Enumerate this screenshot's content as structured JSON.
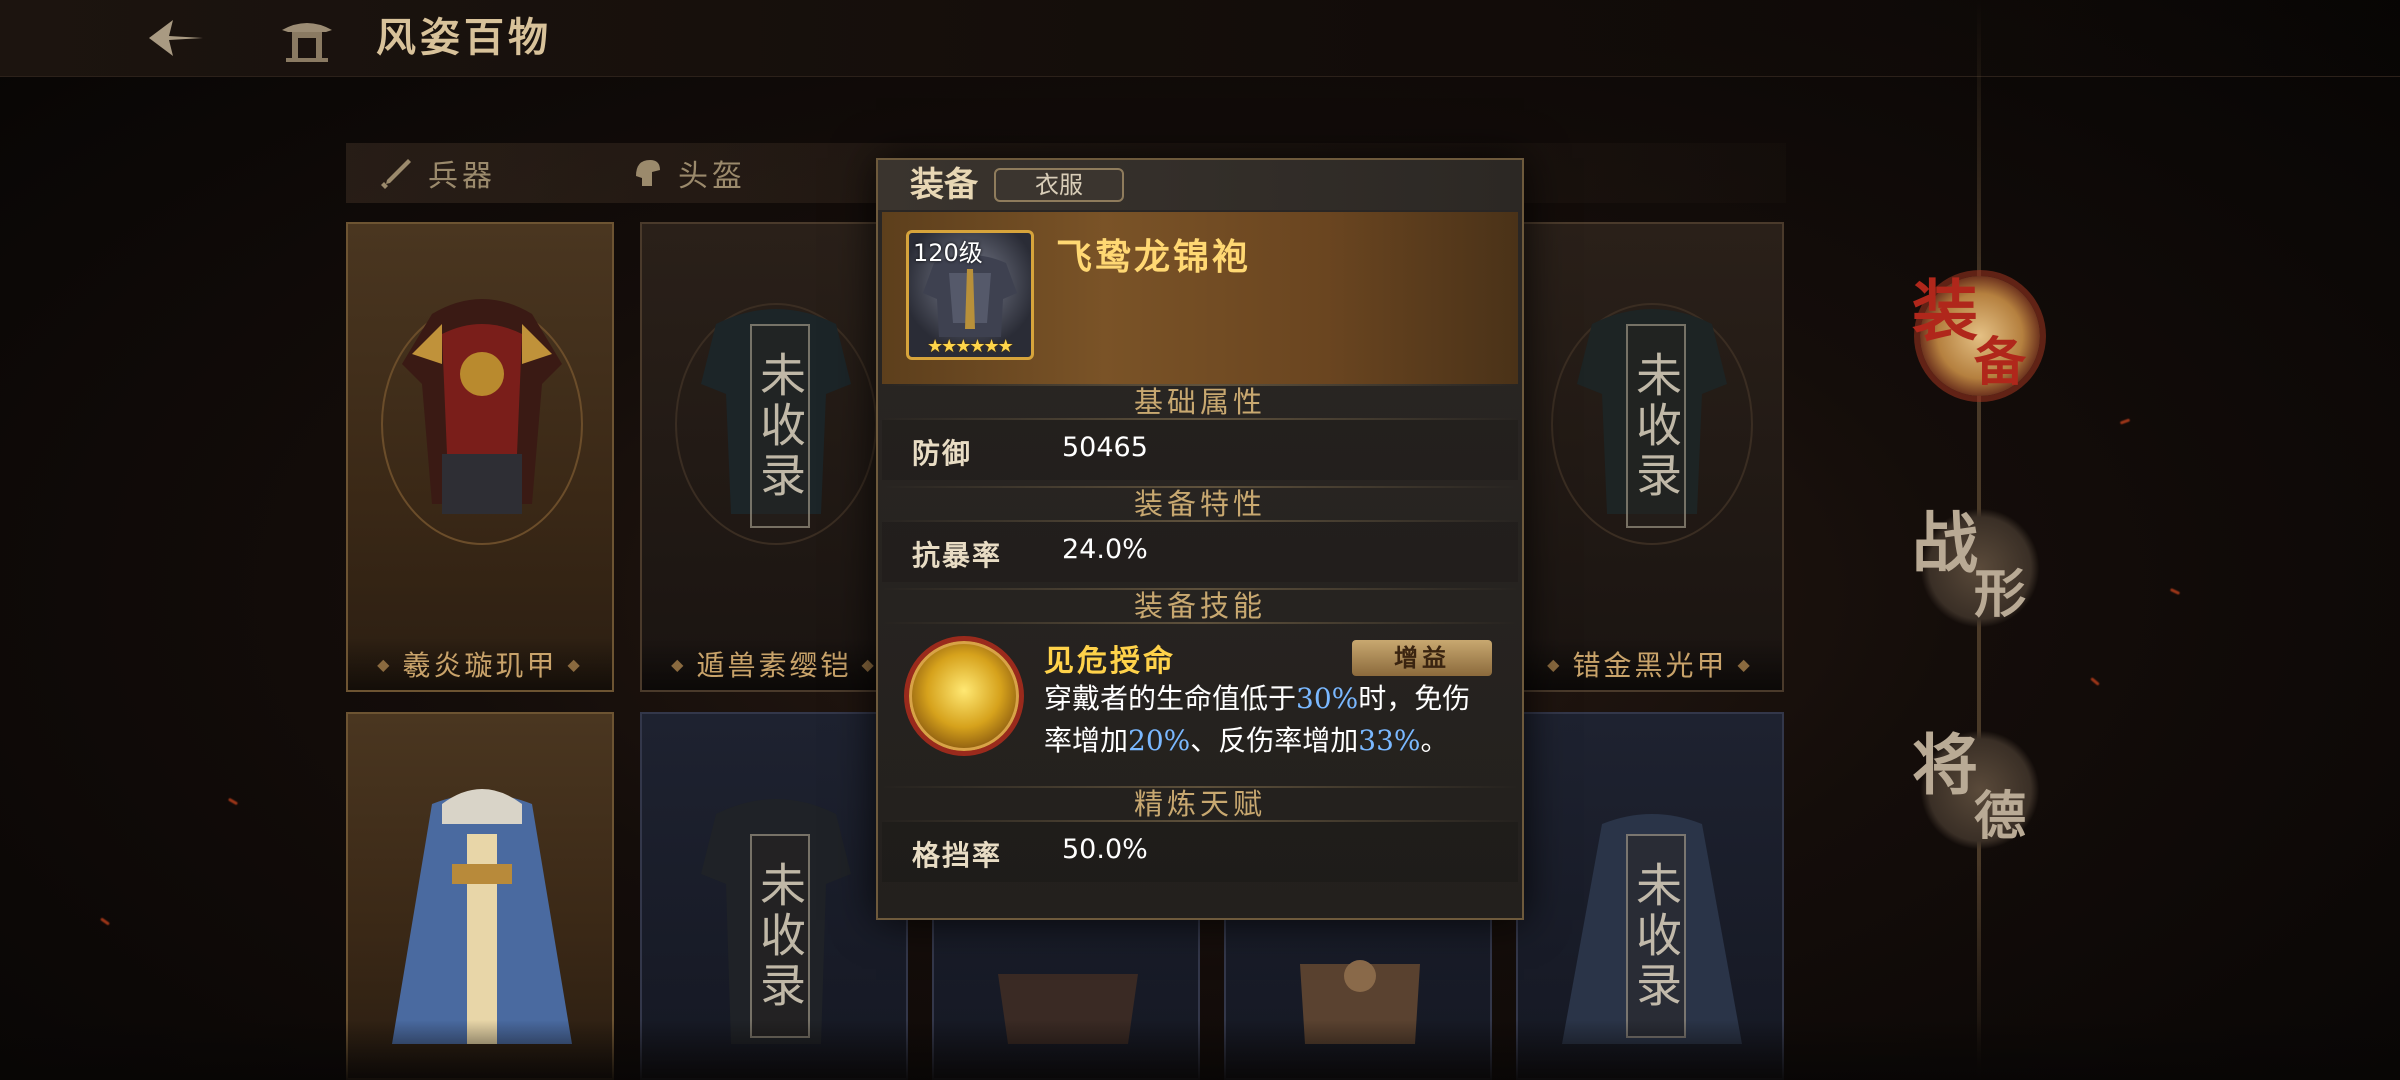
{
  "header": {
    "title": "风姿百物"
  },
  "tabs": [
    {
      "label": "兵器",
      "icon": "sword-icon"
    },
    {
      "label": "头盔",
      "icon": "helmet-icon"
    }
  ],
  "cards_row1": [
    {
      "name": "羲炎璇玑甲",
      "owned": true
    },
    {
      "name": "遁兽素缨铠",
      "owned": false,
      "stamp": "未收录"
    },
    {
      "name": "错金黑光甲",
      "owned": false,
      "stamp": "未收录"
    }
  ],
  "cards_row2": [
    {
      "owned": true
    },
    {
      "owned": false,
      "stamp": "未收录"
    },
    {
      "owned": false
    },
    {
      "owned": false
    },
    {
      "owned": false,
      "stamp": "未收录"
    }
  ],
  "popup": {
    "category": "装备",
    "type": "衣服",
    "item": {
      "level": "120级",
      "stars": "★★★★★★",
      "name": "飞鸷龙锦袍"
    },
    "basic_title": "基础属性",
    "basic": {
      "label": "防御",
      "value": "50465"
    },
    "trait_title": "装备特性",
    "trait": {
      "label": "抗暴率",
      "value": "24.0%"
    },
    "skill_title": "装备技能",
    "skill": {
      "name": "见危授命",
      "tag": "增益",
      "desc_parts": [
        "穿戴者的生命值低于",
        "30%",
        "时，免伤率增加",
        "20%",
        "、反伤率增加",
        "33%",
        "。"
      ]
    },
    "refine_title": "精炼天赋",
    "refine": {
      "label": "格挡率",
      "value": "50.0%"
    }
  },
  "side_nav": [
    {
      "big": "装",
      "small": "备",
      "active": true
    },
    {
      "big": "战",
      "small": "形",
      "active": false
    },
    {
      "big": "将",
      "small": "德",
      "active": false
    }
  ],
  "colors": {
    "accent_gold": "#ffd873",
    "highlight_blue": "#7ab8ff",
    "active_red": "#b0271b"
  }
}
